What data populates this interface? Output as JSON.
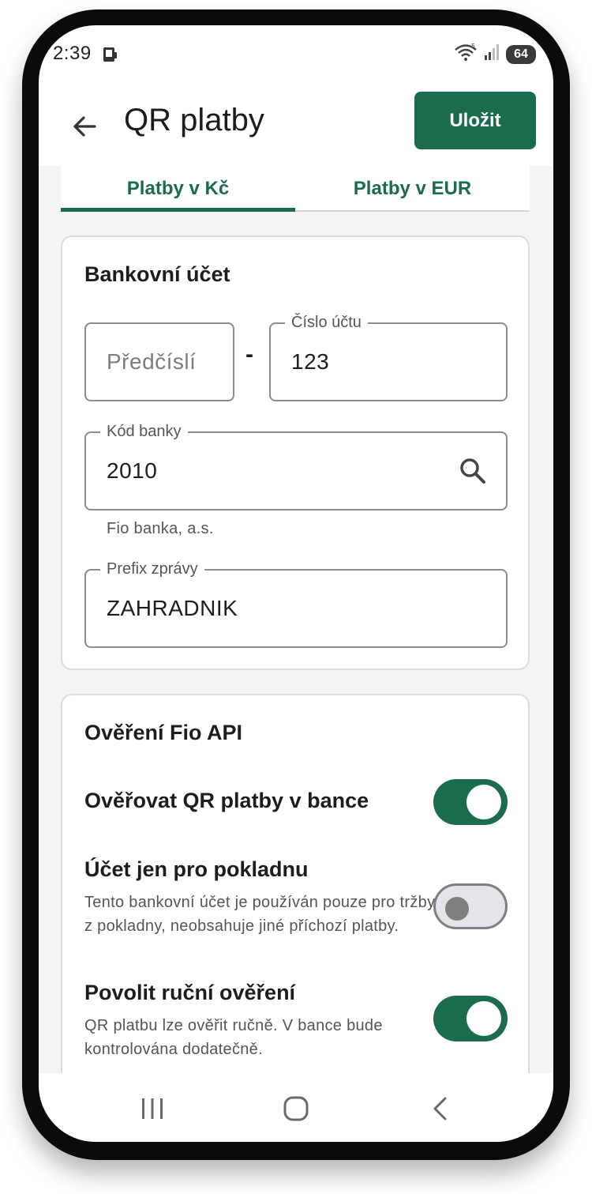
{
  "status_bar": {
    "time": "2:39",
    "battery": "64",
    "left_icon": "phone-icon",
    "right_icons": [
      "wifi-icon",
      "signal-icon",
      "battery-icon"
    ]
  },
  "app_bar": {
    "title": "QR platby",
    "back_icon": "arrow-left-icon",
    "save_label": "Uložit"
  },
  "tabs": [
    {
      "label": "Platby v Kč",
      "selected": true
    },
    {
      "label": "Platby v EUR",
      "selected": false
    }
  ],
  "bank_account": {
    "title": "Bankovní účet",
    "prefix": {
      "placeholder": "Předčíslí",
      "value": ""
    },
    "separator": "-",
    "account_number": {
      "label": "Číslo účtu",
      "value": "123"
    },
    "bank_code": {
      "label": "Kód banky",
      "value": "2010",
      "helper": "Fio banka, a.s.",
      "icon": "search-icon"
    },
    "message_prefix": {
      "label": "Prefix zprávy",
      "value": "ZAHRADNIK"
    }
  },
  "fio_api": {
    "title": "Ověření Fio API",
    "verify": {
      "title": "Ověřovat QR platby v bance",
      "checked": true
    },
    "register_only": {
      "title": "Účet jen pro pokladnu",
      "description": "Tento bankovní účet je používán pouze pro tržby z pokladny, neobsahuje jiné příchozí platby.",
      "checked": false
    },
    "manual": {
      "title": "Povolit ruční ověření",
      "description": "QR platbu lze ověřit ručně. V bance bude kontrolována dodatečně.",
      "checked": true
    }
  },
  "nav_bar": {
    "recents_icon": "recents-icon",
    "home_icon": "home-icon",
    "back_icon": "nav-back-icon"
  },
  "colors": {
    "accent": "#1b6b4d",
    "background": "#f4f4f4",
    "card_border": "#dcdcdc",
    "text": "#1d1d1d",
    "secondary_text": "#555555"
  }
}
